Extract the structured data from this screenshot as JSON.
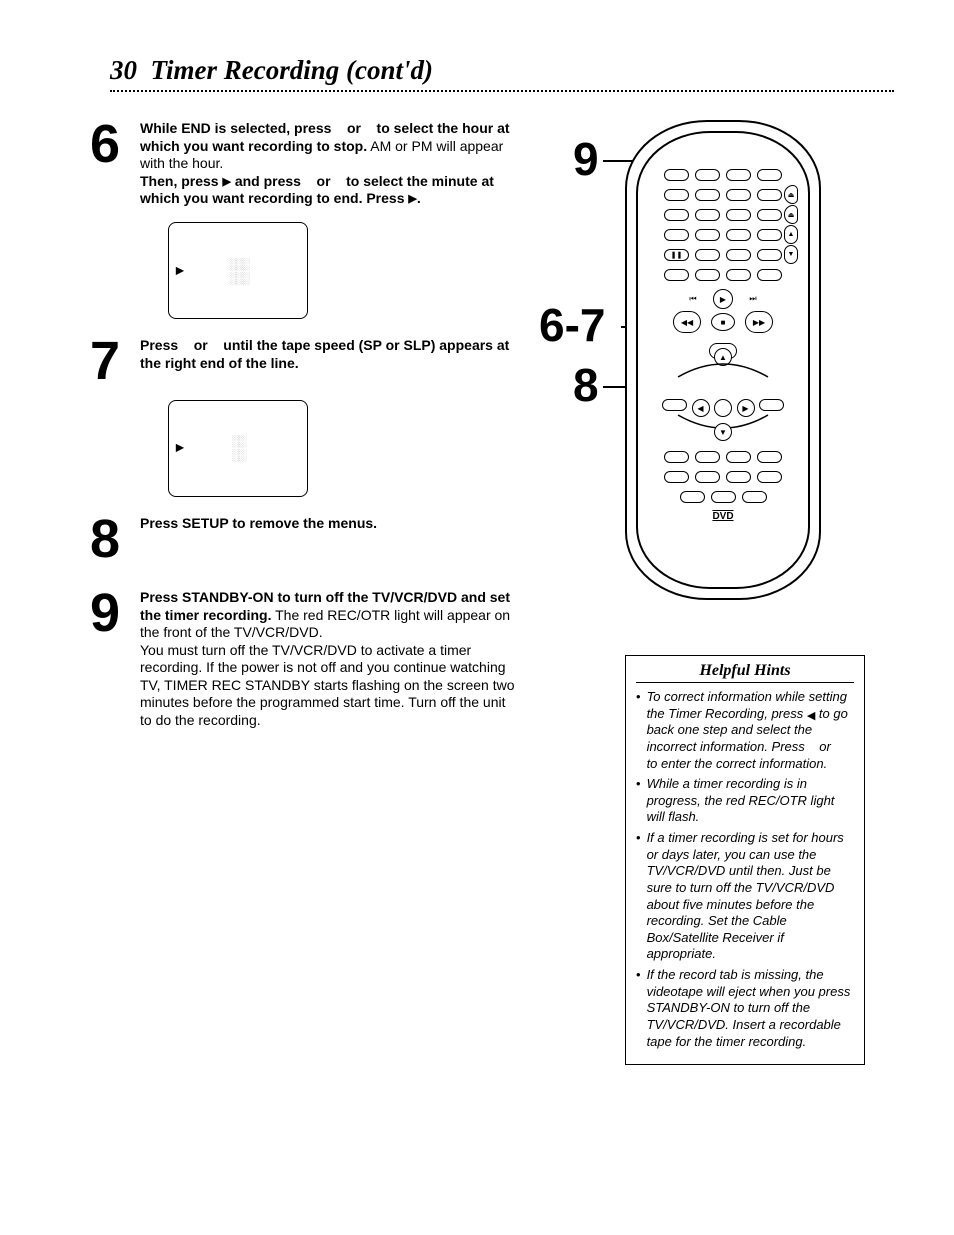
{
  "page": {
    "number": "30",
    "title": "Timer Recording (cont'd)"
  },
  "steps": {
    "s6": {
      "num": "6",
      "line1a": "While END is selected, press ",
      "line1b": " or ",
      "line1c": " to select the hour at which you want recording to stop.",
      "line2": "AM or PM will appear with the hour.",
      "line3a": "Then, press ",
      "line3b": " and press ",
      "line3c": " or ",
      "line3d": " to select the minute at which you want recording to end. Press ",
      "line3e": "."
    },
    "s7": {
      "num": "7",
      "text_a": "Press ",
      "text_b": " or ",
      "text_c": " until the tape speed (SP or SLP) appears at the right end of the line."
    },
    "s8": {
      "num": "8",
      "text": "Press SETUP to remove the menus."
    },
    "s9": {
      "num": "9",
      "bold": "Press STANDBY-ON to turn off the TV/VCR/DVD and set the timer recording.",
      "p1": "The red REC/OTR light will appear on the front of the TV/VCR/DVD.",
      "p2": "You must turn off the TV/VCR/DVD to activate a timer recording. If the power is not off and you continue watching TV, TIMER REC STANDBY starts flashing on the screen two minutes before the programmed start time. Turn off the unit to do the recording."
    }
  },
  "callouts": {
    "top": "9",
    "mid": "6-7",
    "bot": "8"
  },
  "remote": {
    "dvd": "DVD"
  },
  "icons": {
    "play": "▶",
    "skip_prev": "⏮",
    "skip_next": "⏭",
    "rew": "◀◀",
    "ff": "▶▶",
    "stop": "■",
    "up": "▲",
    "down": "▼",
    "left": "◀",
    "right": "▶",
    "pause": "❚❚",
    "eject": "⏏"
  },
  "hints": {
    "title": "Helpful Hints",
    "items": [
      {
        "a": "To correct information while setting the Timer Recording, press ",
        "b": " to go back one step and select the incorrect information. Press ",
        "c": " or ",
        "d": " to enter the correct information."
      },
      {
        "t": "While a timer recording is in progress, the red REC/OTR light will flash."
      },
      {
        "t": "If a timer recording is set for hours or days later, you can use the TV/VCR/DVD until then. Just be sure to turn off the TV/VCR/DVD about five minutes before the recording. Set the Cable Box/Satellite Receiver if appropriate."
      },
      {
        "t": "If the record tab is missing, the videotape will eject when you press STANDBY-ON to turn off the TV/VCR/DVD. Insert a recordable tape for the timer recording."
      }
    ]
  }
}
